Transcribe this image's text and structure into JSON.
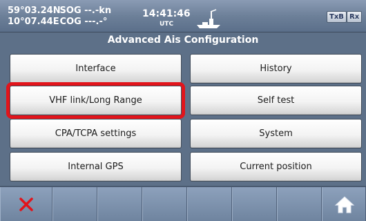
{
  "status": {
    "lat": "59°03.24N",
    "sog": "SOG --.-kn",
    "lon": "10°07.44E",
    "cog": "COG ---.-°",
    "time": "14:41:46",
    "utc_label": "UTC",
    "txb_label": "TxB",
    "rx_label": "Rx"
  },
  "title": "Advanced Ais Configuration",
  "menu": {
    "interface": "Interface",
    "history": "History",
    "vhf_link": "VHF link/Long Range",
    "self_test": "Self test",
    "cpa_tcpa": "CPA/TCPA settings",
    "system": "System",
    "internal_gps": "Internal GPS",
    "current_position": "Current position"
  },
  "selected_item": "vhf_link",
  "colors": {
    "selection": "#e2141b",
    "cancel_icon": "#e2141b",
    "background": "#5d7088"
  },
  "toolbar": {
    "icons": [
      "close-icon",
      "home-icon"
    ]
  }
}
